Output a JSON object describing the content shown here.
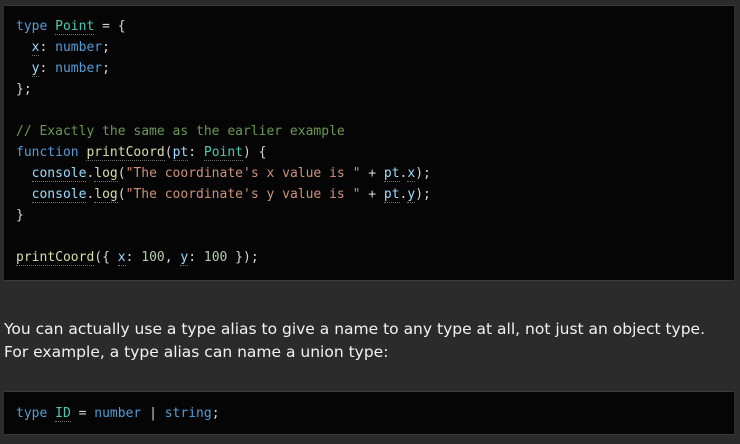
{
  "code_block_1": {
    "line1": {
      "kw": "type",
      "name": "Point",
      "rest": " = {"
    },
    "line2": {
      "prop": "x",
      "colon": ": ",
      "type": "number",
      "semi": ";"
    },
    "line3": {
      "prop": "y",
      "colon": ": ",
      "type": "number",
      "semi": ";"
    },
    "line4": {
      "text": "};"
    },
    "line6": {
      "comment": "// Exactly the same as the earlier example"
    },
    "line7": {
      "kw": "function",
      "fn": "printCoord",
      "open": "(",
      "param": "pt",
      "colon": ": ",
      "ptype": "Point",
      "close": ") {"
    },
    "line8": {
      "obj": "console",
      "dot": ".",
      "method": "log",
      "open": "(",
      "str": "\"The coordinate's x value is \"",
      "plus": " + ",
      "arg_obj": "pt",
      "arg_dot": ".",
      "arg_prop": "x",
      "close": ");"
    },
    "line9": {
      "obj": "console",
      "dot": ".",
      "method": "log",
      "open": "(",
      "str": "\"The coordinate's y value is \"",
      "plus": " + ",
      "arg_obj": "pt",
      "arg_dot": ".",
      "arg_prop": "y",
      "close": ");"
    },
    "line10": {
      "text": "}"
    },
    "line12": {
      "fn": "printCoord",
      "open": "({ ",
      "p1": "x",
      "c1": ": ",
      "n1": "100",
      "comma": ", ",
      "p2": "y",
      "c2": ": ",
      "n2": "100",
      "close": " });"
    }
  },
  "prose": {
    "text": "You can actually use a type alias to give a name to any type at all, not just an object type. For example, a type alias can name a union type:"
  },
  "code_block_2": {
    "kw": "type",
    "name": "ID",
    "eq": " = ",
    "t1": "number",
    "bar": " | ",
    "t2": "string",
    "semi": ";"
  }
}
